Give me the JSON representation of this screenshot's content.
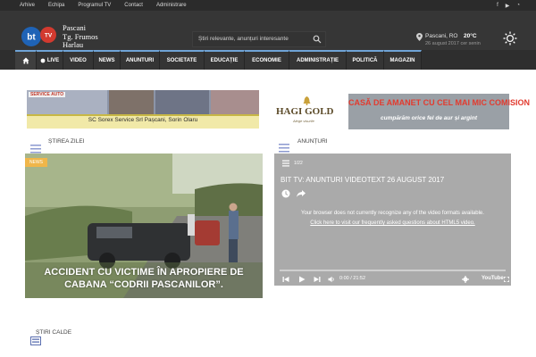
{
  "topbar": {
    "links": [
      "Arhive",
      "Echipa",
      "Programul TV",
      "Contact",
      "Administrare"
    ],
    "social_icons": [
      "facebook-icon",
      "youtube-icon",
      "rss-icon"
    ]
  },
  "header": {
    "logo_text": "bt TV",
    "brand_lines": [
      "Pascani",
      "Tg. Frumos",
      "Harlau"
    ],
    "search_placeholder": "Știri relevante, anunțuri interesante",
    "weather": {
      "city": "Pascani, RO",
      "temperature": "20°C",
      "date": "26 august 2017 cer senin"
    }
  },
  "nav": {
    "items": [
      "LIVE",
      "VIDEO",
      "NEWS",
      "ANUNTURI",
      "SOCIETATE",
      "EDUCAȚIE",
      "ECONOMIE",
      "ADMINISTRAȚIE",
      "POLITICĂ",
      "MAGAZIN"
    ]
  },
  "ads": {
    "left": {
      "label": "SERVICE AUTO",
      "caption": "SC Sorex Service Srl Pașcani, Sorin Olaru"
    },
    "right": {
      "brand": "HAGI GOLD",
      "slogan": "Alege visurile",
      "headline": "CASĂ DE AMANET CU CEL MAI MIC COMISION",
      "subline": "cumpărăm orice fel de aur și argint"
    }
  },
  "sections": {
    "stirea_zilei": "ȘTIREA ZILEI",
    "anunturi": "ANUNȚURI",
    "stiri_calde": "ȘTIRI CALDE"
  },
  "featured": {
    "badge": "NEWS",
    "title": "ACCIDENT CU VICTIME ÎN APROPIERE DE CABANA “CODRII PASCANILOR”."
  },
  "video": {
    "count": "1/22",
    "title": "BIT TV: ANUNTURI VIDEOTEXT 26 AUGUST 2017",
    "message": "Your browser does not currently recognize any of the video formats available.",
    "link": "Click here to visit our frequently asked questions about HTML5 video.",
    "time": "0:00 / 21:52",
    "progress": 0.0,
    "provider": "YouTube"
  },
  "colors": {
    "topbar": "#2b2b2b",
    "header": "#363636",
    "nav": "#2e2e2e",
    "accent": "#6fa3d6",
    "badge": "#f0b64a"
  }
}
